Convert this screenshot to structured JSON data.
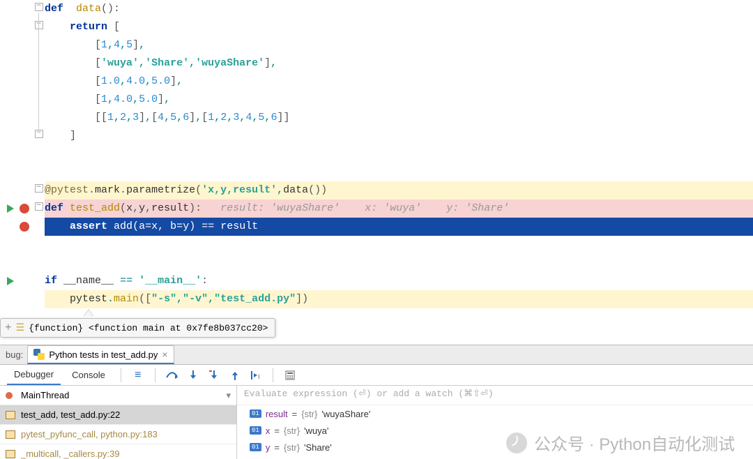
{
  "code": {
    "def_data": "def  data():",
    "return": "return [",
    "l_145": "[1,4,5],",
    "l_wuya": "['wuya','Share','wuyaShare'],",
    "l_floats1": "[1.0,4.0,5.0],",
    "l_floats2": "[1,4.0,5.0],",
    "l_nested": "[[1,2,3],[4,5,6],[1,2,3,4,5,6]]",
    "close": "]",
    "decorator": "@pytest.mark.parametrize('x,y,result',data())",
    "def_test": "def test_add(x,y,result):",
    "inline_vals": "   result: 'wuyaShare'    x: 'wuya'    y: 'Share'",
    "assert": "assert add(a=x, b=y) == result",
    "ifmain": "if __name__ == '__main__':",
    "pytest_main": "pytest.main([\"-s\",\"-v\",\"test_add.py\"])"
  },
  "tooltip": "{function} <function main at 0x7fe8b037cc20>",
  "tabs": {
    "label": "bug:",
    "title": "Python tests in test_add.py"
  },
  "dbgbar": {
    "debugger": "Debugger",
    "console": "Console"
  },
  "frames": {
    "thread": "MainThread",
    "rows": [
      "test_add, test_add.py:22",
      "pytest_pyfunc_call, python.py:183",
      "_multicall, _callers.py:39"
    ]
  },
  "vars": {
    "eval": "Evaluate expression (⏎) or add a watch (⌘⇧⏎)",
    "badge": "01",
    "rows": [
      {
        "name": "result",
        "type": "{str}",
        "val": "'wuyaShare'"
      },
      {
        "name": "x",
        "type": "{str}",
        "val": "'wuya'"
      },
      {
        "name": "y",
        "type": "{str}",
        "val": "'Share'"
      }
    ]
  },
  "watermark": "公众号 · Python自动化测试"
}
